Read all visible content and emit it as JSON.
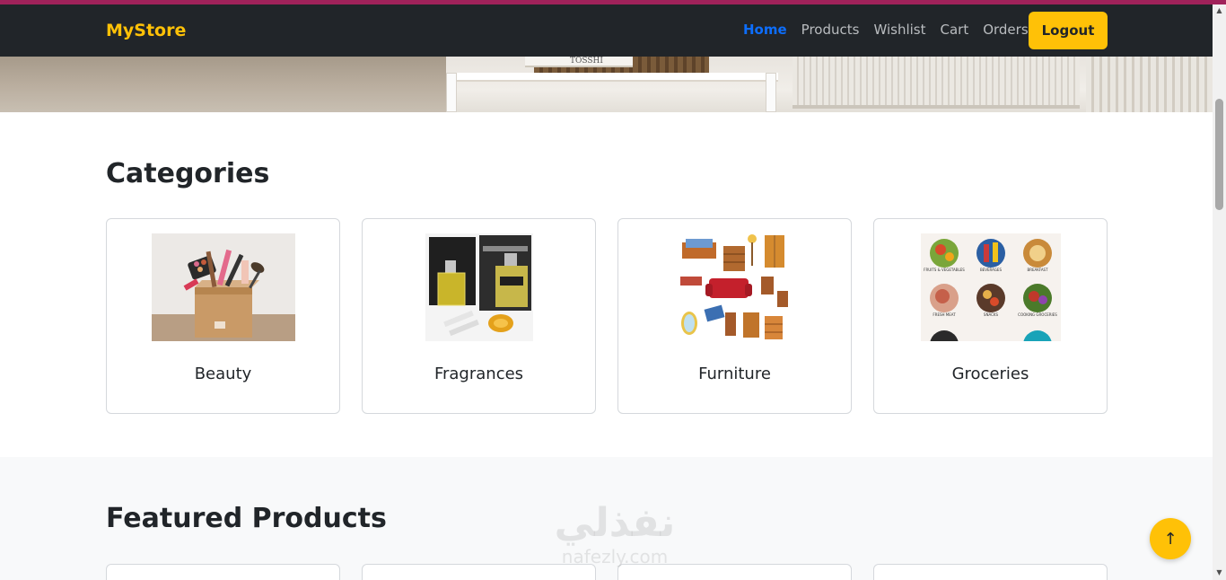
{
  "navbar": {
    "brand": "MyStore",
    "links": [
      {
        "label": "Home",
        "active": true
      },
      {
        "label": "Products",
        "active": false
      },
      {
        "label": "Wishlist",
        "active": false
      },
      {
        "label": "Cart",
        "active": false
      },
      {
        "label": "Orders",
        "active": false
      }
    ],
    "logout_label": "Logout"
  },
  "hero": {
    "book_text": "TOSSHI"
  },
  "categories": {
    "title": "Categories",
    "items": [
      {
        "name": "Beauty",
        "image_icon": "beauty-products-box-image"
      },
      {
        "name": "Fragrances",
        "image_icon": "perfume-bottles-image"
      },
      {
        "name": "Furniture",
        "image_icon": "furniture-collection-image"
      },
      {
        "name": "Groceries",
        "image_icon": "grocery-categories-image"
      }
    ]
  },
  "groceries_labels": [
    "FRUITS & VEGETABLES",
    "BEVERAGES",
    "BREAKFAST",
    "FRESH MEAT",
    "SNACKS",
    "COOKING GROCERIES"
  ],
  "featured": {
    "title": "Featured Products"
  },
  "watermark": {
    "arabic": "نفذلي",
    "latin": "nafezly.com"
  },
  "scroll_top_icon": "arrow-up-icon",
  "colors": {
    "brand": "#ffc107",
    "active_link": "#0d6efd",
    "navbar_bg": "#212529",
    "accent_bar": "#a0225a"
  }
}
